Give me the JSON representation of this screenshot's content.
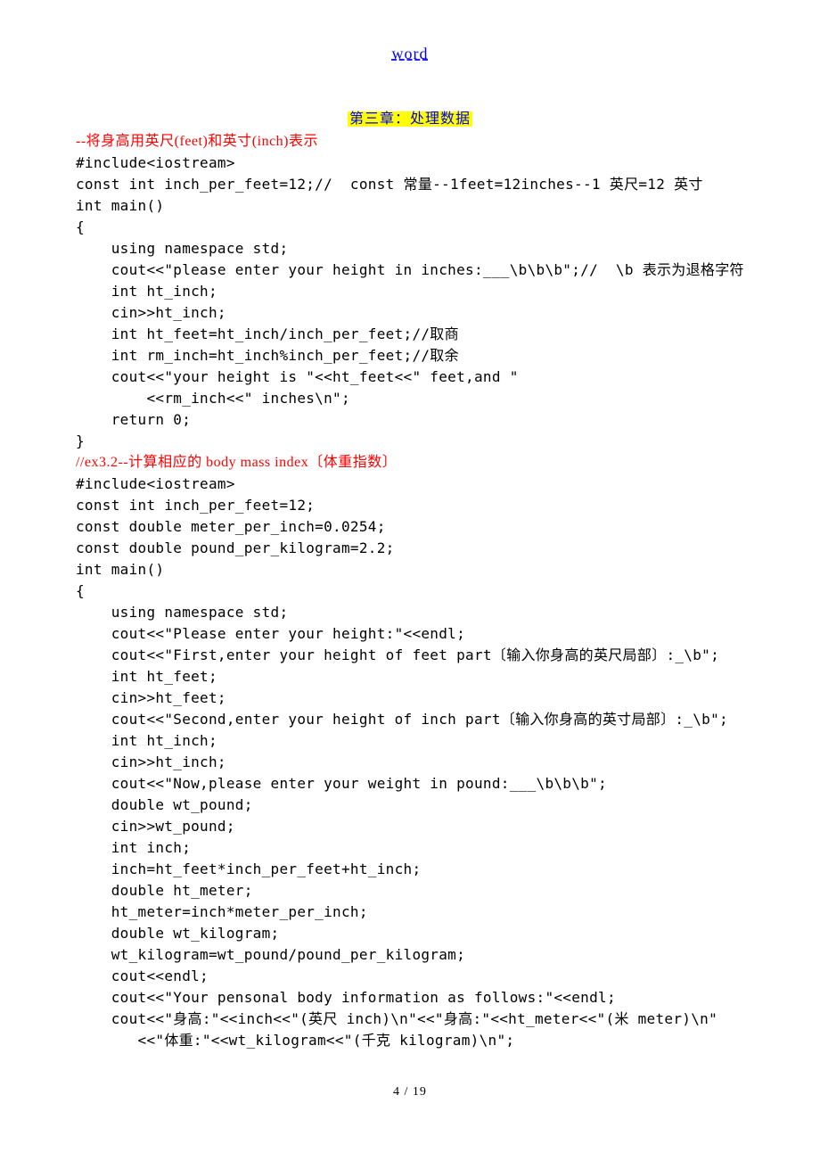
{
  "header": {
    "link_text": "word"
  },
  "chapter": {
    "title": "第三章：处理数据"
  },
  "section1": {
    "title": "--将身高用英尺(feet)和英寸(inch)表示",
    "lines": [
      "#include<iostream>",
      "const int inch_per_feet=12;//  const 常量--1feet=12inches--1 英尺=12 英寸",
      "int main()",
      "{",
      "    using namespace std;",
      "    cout<<\"please enter your height in inches:___\\b\\b\\b\";//  \\b 表示为退格字符",
      "    int ht_inch;",
      "    cin>>ht_inch;",
      "    int ht_feet=ht_inch/inch_per_feet;//取商",
      "    int rm_inch=ht_inch%inch_per_feet;//取余",
      "    cout<<\"your height is \"<<ht_feet<<\" feet,and \"",
      "        <<rm_inch<<\" inches\\n\";",
      "    return 0;",
      "}"
    ]
  },
  "section2": {
    "title": "//ex3.2--计算相应的 body mass index〔体重指数〕",
    "lines": [
      "#include<iostream>",
      "const int inch_per_feet=12;",
      "const double meter_per_inch=0.0254;",
      "const double pound_per_kilogram=2.2;",
      "int main()",
      "{",
      "    using namespace std;",
      "    cout<<\"Please enter your height:\"<<endl;",
      "    cout<<\"First,enter your height of feet part〔输入你身高的英尺局部〕:_\\b\";",
      "    int ht_feet;",
      "    cin>>ht_feet;",
      "    cout<<\"Second,enter your height of inch part〔输入你身高的英寸局部〕:_\\b\";",
      "    int ht_inch;",
      "    cin>>ht_inch;",
      "    cout<<\"Now,please enter your weight in pound:___\\b\\b\\b\";",
      "    double wt_pound;",
      "    cin>>wt_pound;",
      "    int inch;",
      "    inch=ht_feet*inch_per_feet+ht_inch;",
      "    double ht_meter;",
      "    ht_meter=inch*meter_per_inch;",
      "    double wt_kilogram;",
      "    wt_kilogram=wt_pound/pound_per_kilogram;",
      "    cout<<endl;",
      "    cout<<\"Your pensonal body information as follows:\"<<endl;",
      "    cout<<\"身高:\"<<inch<<\"(英尺 inch)\\n\"<<\"身高:\"<<ht_meter<<\"(米 meter)\\n\"",
      "       <<\"体重:\"<<wt_kilogram<<\"(千克 kilogram)\\n\";"
    ]
  },
  "footer": {
    "page_number": "4 / 19"
  }
}
